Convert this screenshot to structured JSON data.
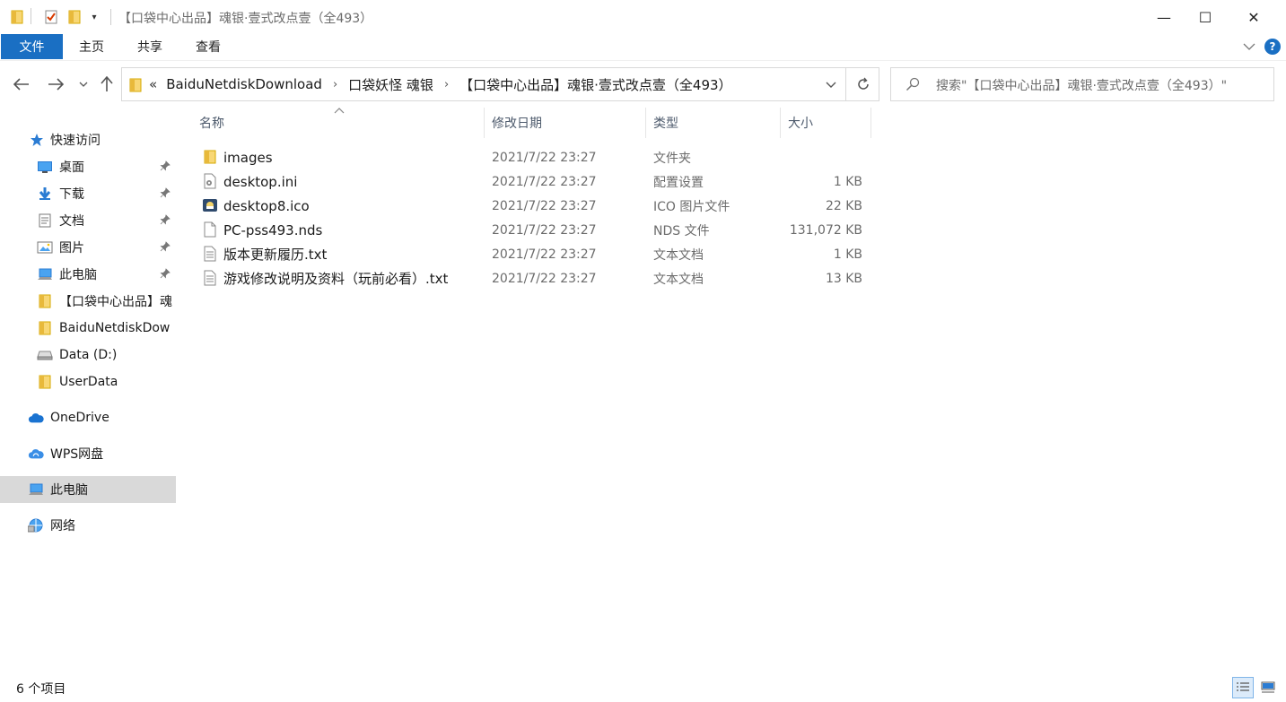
{
  "window": {
    "title": "【口袋中心出品】魂银·壹式改点壹（全493）",
    "minimize": "—",
    "maximize": "☐",
    "close": "✕"
  },
  "ribbon": {
    "tabs": [
      "文件",
      "主页",
      "共享",
      "查看"
    ],
    "help": "?"
  },
  "address": {
    "overflow": "«",
    "crumbs": [
      "BaiduNetdiskDownload",
      "口袋妖怪 魂银",
      "【口袋中心出品】魂银·壹式改点壹（全493）"
    ],
    "separator": "›"
  },
  "search": {
    "placeholder": "搜索\"【口袋中心出品】魂银·壹式改点壹（全493）\""
  },
  "sidebar": {
    "items": [
      {
        "label": "快速访问",
        "icon": "star-icon"
      },
      {
        "label": "桌面",
        "icon": "desktop-icon",
        "pinned": true
      },
      {
        "label": "下载",
        "icon": "download-icon",
        "pinned": true
      },
      {
        "label": "文档",
        "icon": "document-icon",
        "pinned": true
      },
      {
        "label": "图片",
        "icon": "picture-icon",
        "pinned": true
      },
      {
        "label": "此电脑",
        "icon": "computer-icon",
        "pinned": true
      },
      {
        "label": "【口袋中心出品】魂",
        "icon": "folder-icon"
      },
      {
        "label": "BaiduNetdiskDow",
        "icon": "folder-icon"
      },
      {
        "label": "Data (D:)",
        "icon": "drive-icon"
      },
      {
        "label": "UserData",
        "icon": "folder-icon"
      },
      {
        "label": "OneDrive",
        "icon": "cloud-icon"
      },
      {
        "label": "WPS网盘",
        "icon": "wps-cloud-icon"
      },
      {
        "label": "此电脑",
        "icon": "computer-icon",
        "selected": true
      },
      {
        "label": "网络",
        "icon": "network-icon"
      }
    ]
  },
  "columns": {
    "name": "名称",
    "date": "修改日期",
    "type": "类型",
    "size": "大小"
  },
  "files": [
    {
      "name": "images",
      "date": "2021/7/22 23:27",
      "type": "文件夹",
      "size": "",
      "icon": "folder-icon"
    },
    {
      "name": "desktop.ini",
      "date": "2021/7/22 23:27",
      "type": "配置设置",
      "size": "1 KB",
      "icon": "settings-file-icon"
    },
    {
      "name": "desktop8.ico",
      "date": "2021/7/22 23:27",
      "type": "ICO 图片文件",
      "size": "22 KB",
      "icon": "image-file-icon"
    },
    {
      "name": "PC-pss493.nds",
      "date": "2021/7/22 23:27",
      "type": "NDS 文件",
      "size": "131,072 KB",
      "icon": "blank-file-icon"
    },
    {
      "name": "版本更新履历.txt",
      "date": "2021/7/22 23:27",
      "type": "文本文档",
      "size": "1 KB",
      "icon": "text-file-icon"
    },
    {
      "name": "游戏修改说明及资料（玩前必看）.txt",
      "date": "2021/7/22 23:27",
      "type": "文本文档",
      "size": "13 KB",
      "icon": "text-file-icon"
    }
  ],
  "status": {
    "count": "6 个项目"
  },
  "colors": {
    "accent": "#1a6fc3",
    "folder": "#f8d775",
    "selected_bg": "#d9d9d9"
  }
}
